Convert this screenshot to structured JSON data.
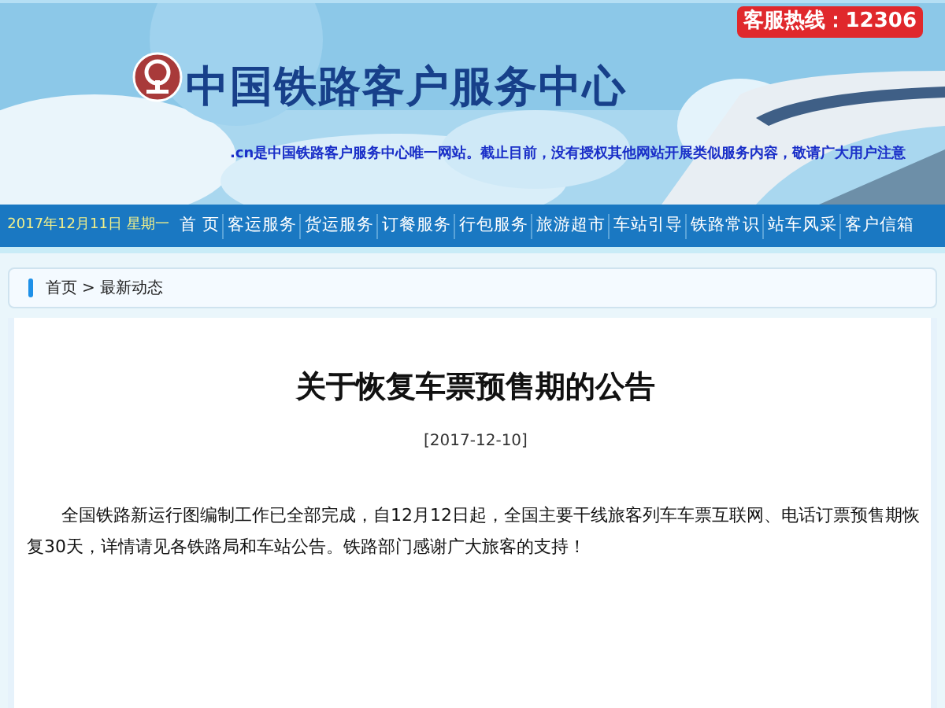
{
  "banner": {
    "title": "中国铁路客户服务中心",
    "hotline": "客服热线：12306",
    "notice": ".cn是中国铁路客户服务中心唯一网站。截止目前，没有授权其他网站开展类似服务内容，敬请广大用户注意"
  },
  "nav": {
    "date": "2017年12月11日 星期一",
    "items": [
      "首 页",
      "客运服务",
      "货运服务",
      "订餐服务",
      "行包服务",
      "旅游超市",
      "车站引导",
      "铁路常识",
      "站车风采",
      "客户信箱"
    ]
  },
  "breadcrumb": [
    "首页",
    ">",
    "最新动态"
  ],
  "article": {
    "title": "关于恢复车票预售期的公告",
    "date": "[2017-12-10]",
    "body": "全国铁路新运行图编制工作已全部完成，自12月12日起，全国主要干线旅客列车车票互联网、电话订票预售期恢复30天，详情请见各铁路局和车站公告。铁路部门感谢广大旅客的支持！"
  }
}
